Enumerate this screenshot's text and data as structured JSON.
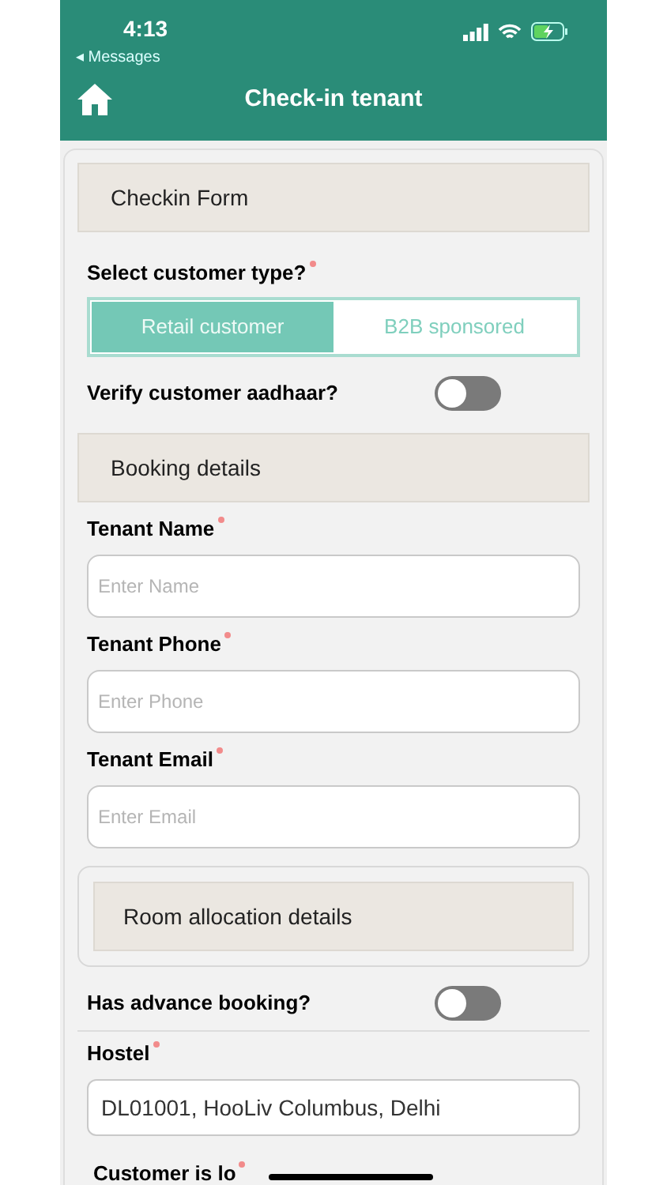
{
  "status_bar": {
    "time": "4:13",
    "back_label": "◂ Messages"
  },
  "header": {
    "title": "Check-in tenant"
  },
  "form": [
    {
      "kind": "section",
      "title": "Checkin Form"
    },
    {
      "kind": "segmented",
      "label": "Select customer type?",
      "required": true,
      "options": [
        {
          "label": "Retail customer",
          "selected": true
        },
        {
          "label": "B2B sponsored",
          "selected": false
        }
      ]
    },
    {
      "kind": "toggle",
      "label": "Verify customer aadhaar?",
      "on": false
    },
    {
      "kind": "section",
      "title": "Booking details"
    },
    {
      "kind": "text",
      "label": "Tenant Name",
      "required": true,
      "placeholder": "Enter Name"
    },
    {
      "kind": "text",
      "label": "Tenant Phone",
      "required": true,
      "placeholder": "Enter Phone"
    },
    {
      "kind": "text",
      "label": "Tenant Email",
      "required": true,
      "placeholder": "Enter Email"
    },
    {
      "kind": "card",
      "title": "Room allocation details"
    },
    {
      "kind": "toggle",
      "label": "Has advance booking?",
      "on": false,
      "divider": true
    },
    {
      "kind": "value",
      "label": "Hostel",
      "required": true,
      "value": "DL01001, HooLiv Columbus, Delhi"
    },
    {
      "kind": "label",
      "label": "Customer is lo",
      "required": true
    }
  ]
}
